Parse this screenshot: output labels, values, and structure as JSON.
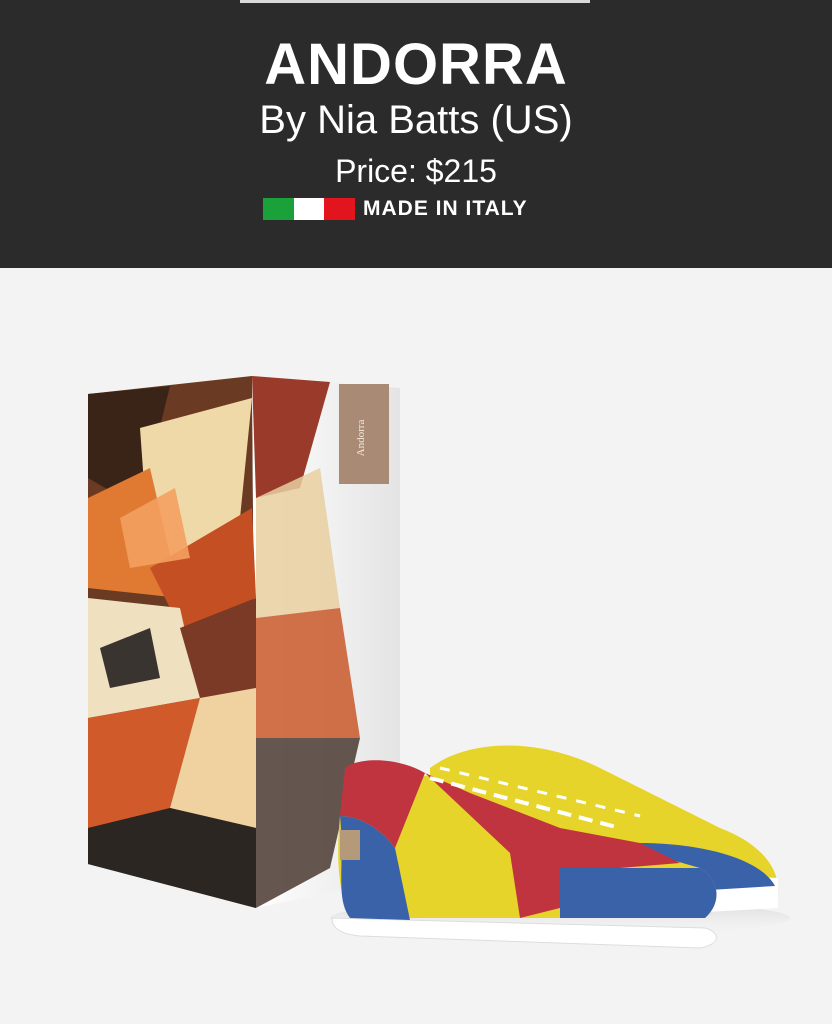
{
  "product": {
    "name": "ANDORRA",
    "designer_line": "By Nia Batts (US)",
    "price_line": "Price: $215",
    "origin_label": "MADE IN ITALY"
  },
  "flag": {
    "green": "#1aa13a",
    "white": "#ffffff",
    "red": "#e2141e"
  },
  "box_label": {
    "brand_text": "Andorra"
  },
  "colors": {
    "header_bg": "#2b2b2b",
    "page_bg": "#f3f3f3",
    "shoe_yellow": "#e6d42a",
    "shoe_blue": "#3a62a8",
    "shoe_red": "#c0343f"
  },
  "icons": [
    "italy-flag-icon"
  ]
}
